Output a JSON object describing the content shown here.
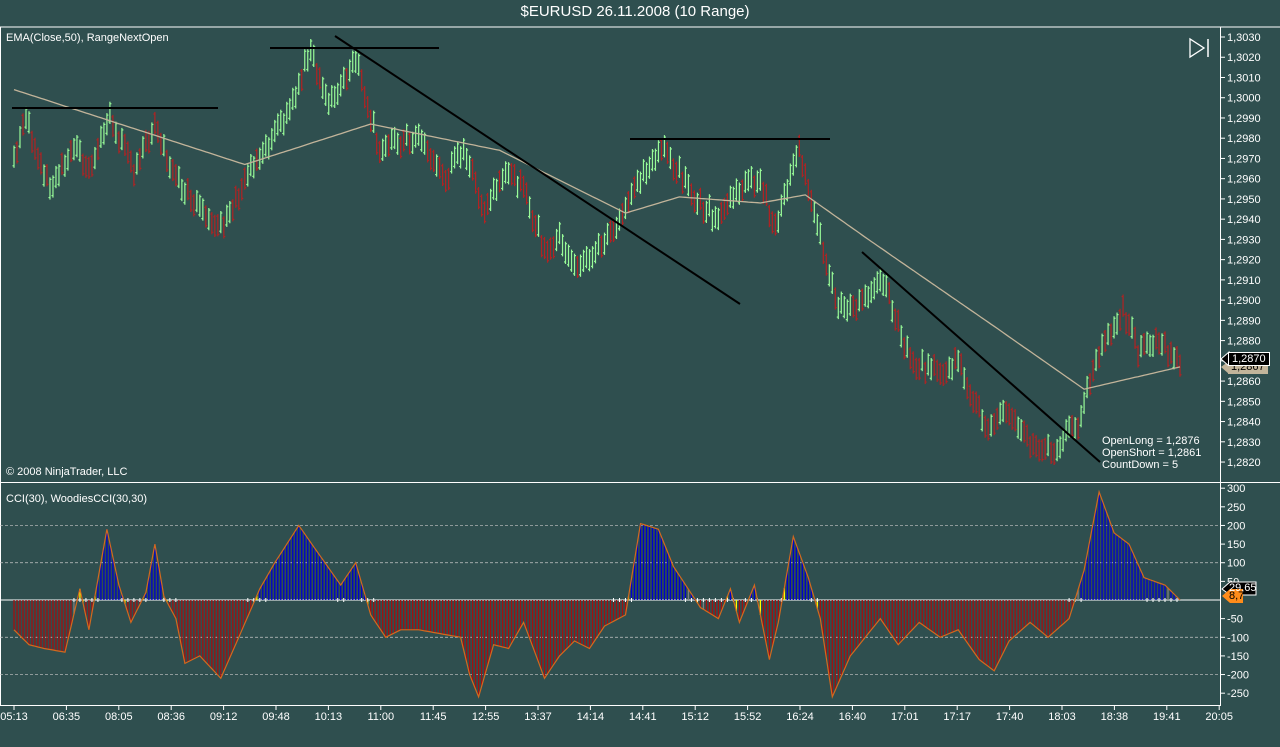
{
  "window": {
    "title": "$EURUSD  26.11.2008 (10 Range)"
  },
  "price_panel": {
    "indicator_label": "EMA(Close,50), RangeNextOpen",
    "copyright": "© 2008 NinjaTrader, LLC",
    "info": [
      "OpenLong = 1,2876",
      "OpenShort = 1,2861",
      "CountDown = 5"
    ],
    "last_price_label": "1,2870",
    "ema_label": "1,2867"
  },
  "cci_panel": {
    "indicator_label": "CCI(30), WoodiesCCI(30,30)",
    "cci_label": "29,65",
    "woodies_label": "8,7"
  },
  "colors": {
    "background": "#2f4f4f",
    "up_bar": "#98fb98",
    "down_bar": "#b22222",
    "ema": "#c2b49a",
    "cci_pos": "#0000cd",
    "cci_neg": "#a01010",
    "cci_neutral": "#808080",
    "cci_line": "#d2691e",
    "trend_line": "#000000"
  },
  "chart_data": [
    {
      "type": "ohlc",
      "title": "$EURUSD 26.11.2008 (10 Range)",
      "ylim": [
        1.2815,
        1.3035
      ],
      "y_ticks": [
        1.303,
        1.302,
        1.301,
        1.3,
        1.299,
        1.298,
        1.297,
        1.296,
        1.295,
        1.294,
        1.293,
        1.292,
        1.291,
        1.29,
        1.289,
        1.288,
        1.287,
        1.286,
        1.285,
        1.284,
        1.283,
        1.282
      ],
      "x_ticks": [
        "05:13",
        "06:35",
        "08:05",
        "08:36",
        "09:12",
        "09:48",
        "10:13",
        "11:00",
        "11:45",
        "12:55",
        "13:37",
        "14:14",
        "14:41",
        "15:12",
        "15:52",
        "16:24",
        "16:40",
        "17:01",
        "17:17",
        "17:40",
        "18:03",
        "18:38",
        "19:41",
        "20:05"
      ],
      "bar_count": 390,
      "close_path": [
        [
          0,
          1.297
        ],
        [
          4,
          1.299
        ],
        [
          12,
          1.2955
        ],
        [
          20,
          1.2975
        ],
        [
          25,
          1.2965
        ],
        [
          32,
          1.299
        ],
        [
          40,
          1.2965
        ],
        [
          47,
          1.2985
        ],
        [
          54,
          1.296
        ],
        [
          60,
          1.295
        ],
        [
          70,
          1.2935
        ],
        [
          77,
          1.296
        ],
        [
          85,
          1.2975
        ],
        [
          94,
          1.3
        ],
        [
          99,
          1.3025
        ],
        [
          105,
          1.2995
        ],
        [
          114,
          1.302
        ],
        [
          122,
          1.2975
        ],
        [
          135,
          1.298
        ],
        [
          144,
          1.296
        ],
        [
          150,
          1.2975
        ],
        [
          157,
          1.2945
        ],
        [
          164,
          1.2965
        ],
        [
          170,
          1.2955
        ],
        [
          177,
          1.2925
        ],
        [
          182,
          1.293
        ],
        [
          188,
          1.2915
        ],
        [
          195,
          1.2925
        ],
        [
          200,
          1.2935
        ],
        [
          209,
          1.296
        ],
        [
          217,
          1.2975
        ],
        [
          225,
          1.2955
        ],
        [
          234,
          1.294
        ],
        [
          242,
          1.2955
        ],
        [
          249,
          1.296
        ],
        [
          254,
          1.2935
        ],
        [
          262,
          1.2975
        ],
        [
          267,
          1.2945
        ],
        [
          275,
          1.2895
        ],
        [
          285,
          1.29
        ],
        [
          290,
          1.291
        ],
        [
          299,
          1.287
        ],
        [
          309,
          1.2865
        ],
        [
          315,
          1.287
        ],
        [
          325,
          1.2835
        ],
        [
          332,
          1.2845
        ],
        [
          339,
          1.283
        ],
        [
          347,
          1.2825
        ],
        [
          355,
          1.284
        ],
        [
          362,
          1.2875
        ],
        [
          370,
          1.2895
        ],
        [
          375,
          1.2875
        ],
        [
          382,
          1.288
        ],
        [
          389,
          1.287
        ]
      ],
      "ema_path": [
        [
          0,
          1.3004
        ],
        [
          77,
          1.2967
        ],
        [
          119,
          1.2987
        ],
        [
          162,
          1.2974
        ],
        [
          204,
          1.2943
        ],
        [
          222,
          1.2951
        ],
        [
          249,
          1.2948
        ],
        [
          264,
          1.2952
        ],
        [
          285,
          1.293
        ],
        [
          329,
          1.2885
        ],
        [
          357,
          1.2856
        ],
        [
          389,
          1.2867
        ]
      ]
    },
    {
      "type": "bar",
      "title": "CCI(30), WoodiesCCI(30,30)",
      "ylim": [
        -265,
        305
      ],
      "y_ticks": [
        300,
        250,
        200,
        150,
        100,
        50,
        -50,
        -100,
        -150,
        -200,
        -250
      ],
      "grid": [
        200,
        100,
        -100,
        -200
      ],
      "cci_path": [
        [
          0,
          -80
        ],
        [
          5,
          -120
        ],
        [
          10,
          -130
        ],
        [
          17,
          -140
        ],
        [
          22,
          30
        ],
        [
          25,
          -80
        ],
        [
          31,
          190
        ],
        [
          35,
          40
        ],
        [
          39,
          -60
        ],
        [
          44,
          20
        ],
        [
          47,
          150
        ],
        [
          50,
          10
        ],
        [
          54,
          -50
        ],
        [
          57,
          -170
        ],
        [
          62,
          -150
        ],
        [
          69,
          -210
        ],
        [
          75,
          -100
        ],
        [
          82,
          30
        ],
        [
          87,
          100
        ],
        [
          95,
          200
        ],
        [
          102,
          120
        ],
        [
          109,
          40
        ],
        [
          114,
          100
        ],
        [
          119,
          -40
        ],
        [
          124,
          -100
        ],
        [
          129,
          -80
        ],
        [
          135,
          -80
        ],
        [
          142,
          -90
        ],
        [
          149,
          -100
        ],
        [
          152,
          -200
        ],
        [
          155,
          -260
        ],
        [
          160,
          -120
        ],
        [
          165,
          -130
        ],
        [
          170,
          -60
        ],
        [
          177,
          -210
        ],
        [
          182,
          -150
        ],
        [
          187,
          -110
        ],
        [
          192,
          -130
        ],
        [
          197,
          -70
        ],
        [
          204,
          -40
        ],
        [
          209,
          205
        ],
        [
          215,
          190
        ],
        [
          220,
          90
        ],
        [
          229,
          -20
        ],
        [
          235,
          -50
        ],
        [
          239,
          30
        ],
        [
          242,
          -60
        ],
        [
          247,
          40
        ],
        [
          252,
          -160
        ],
        [
          255,
          -60
        ],
        [
          260,
          170
        ],
        [
          265,
          60
        ],
        [
          269,
          -50
        ],
        [
          273,
          -260
        ],
        [
          279,
          -150
        ],
        [
          289,
          -50
        ],
        [
          295,
          -120
        ],
        [
          302,
          -60
        ],
        [
          309,
          -100
        ],
        [
          315,
          -80
        ],
        [
          322,
          -160
        ],
        [
          327,
          -190
        ],
        [
          332,
          -110
        ],
        [
          339,
          -60
        ],
        [
          345,
          -100
        ],
        [
          352,
          -50
        ],
        [
          357,
          80
        ],
        [
          362,
          290
        ],
        [
          367,
          180
        ],
        [
          372,
          150
        ],
        [
          377,
          60
        ],
        [
          384,
          40
        ],
        [
          389,
          0
        ]
      ]
    }
  ]
}
